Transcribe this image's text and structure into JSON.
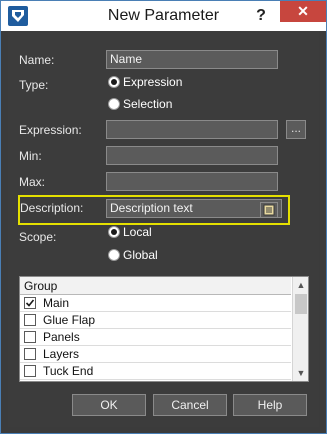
{
  "window": {
    "title": "New Parameter",
    "help_glyph": "?",
    "close_glyph": "✕"
  },
  "form": {
    "name_label": "Name:",
    "name_value": "Name",
    "type_label": "Type:",
    "type_options": [
      "Expression",
      "Selection"
    ],
    "type_selected": "Expression",
    "expression_label": "Expression:",
    "expression_value": "",
    "expression_browse": "...",
    "min_label": "Min:",
    "min_value": "",
    "max_label": "Max:",
    "max_value": "",
    "description_label": "Description:",
    "description_value": "Description text",
    "scope_label": "Scope:",
    "scope_options": [
      "Local",
      "Global"
    ],
    "scope_selected": "Local"
  },
  "group_list": {
    "header": "Group",
    "items": [
      {
        "label": "Main",
        "checked": true
      },
      {
        "label": "Glue Flap",
        "checked": false
      },
      {
        "label": "Panels",
        "checked": false
      },
      {
        "label": "Layers",
        "checked": false
      },
      {
        "label": "Tuck End",
        "checked": false
      }
    ]
  },
  "buttons": {
    "ok": "OK",
    "cancel": "Cancel",
    "help": "Help"
  },
  "colors": {
    "titlebar": "#ffffff",
    "background": "#3c3c3c",
    "field": "#5b5b5b",
    "highlight": "#e5e000",
    "close": "#c7463e",
    "icon": "#1f5c9e"
  },
  "icons": {
    "app": "app-logo-icon",
    "description": "edit-text-icon",
    "check": "check-icon"
  }
}
